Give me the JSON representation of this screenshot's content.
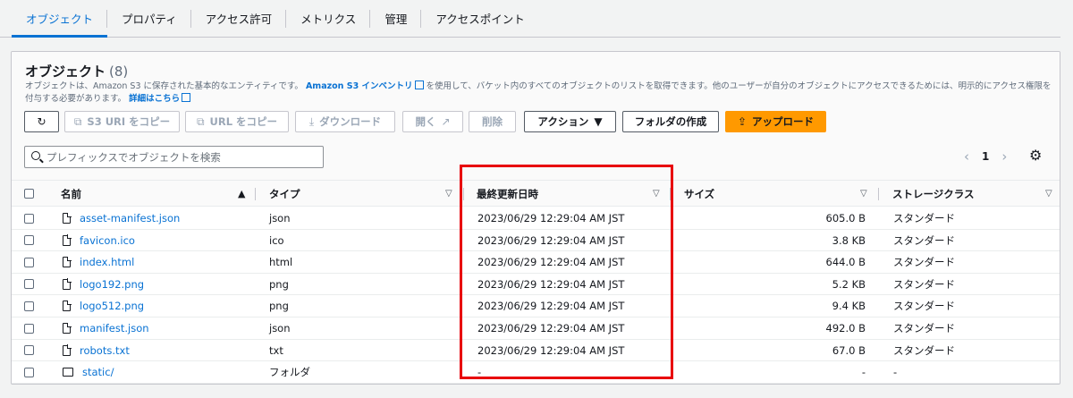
{
  "tabs": [
    {
      "label": "オブジェクト",
      "active": true
    },
    {
      "label": "プロパティ",
      "active": false
    },
    {
      "label": "アクセス許可",
      "active": false
    },
    {
      "label": "メトリクス",
      "active": false
    },
    {
      "label": "管理",
      "active": false
    },
    {
      "label": "アクセスポイント",
      "active": false
    }
  ],
  "objects": {
    "title": "オブジェクト",
    "count": "(8)",
    "description_pre": "オブジェクトは、Amazon S3 に保存された基本的なエンティティです。",
    "inventory_link": "Amazon S3 インベントリ",
    "description_mid": "を使用して、バケット内のすべてのオブジェクトのリストを取得できます。他のユーザーが自分のオブジェクトにアクセスできるためには、明示的にアクセス権限を付与する必要があります。",
    "details_link": "詳細はこちら"
  },
  "toolbar": {
    "copy_s3_uri": "S3 URI をコピー",
    "copy_url": "URL をコピー",
    "download": "ダウンロード",
    "open": "開く",
    "delete": "削除",
    "actions": "アクション",
    "create_folder": "フォルダの作成",
    "upload": "アップロード"
  },
  "search": {
    "placeholder": "プレフィックスでオブジェクトを検索"
  },
  "pagination": {
    "page": "1"
  },
  "table": {
    "columns": [
      "名前",
      "タイプ",
      "最終更新日時",
      "サイズ",
      "ストレージクラス"
    ],
    "rows": [
      {
        "name": "asset-manifest.json",
        "type": "json",
        "modified": "2023/06/29 12:29:04 AM JST",
        "size": "605.0 B",
        "storage": "スタンダード",
        "kind": "file"
      },
      {
        "name": "favicon.ico",
        "type": "ico",
        "modified": "2023/06/29 12:29:04 AM JST",
        "size": "3.8 KB",
        "storage": "スタンダード",
        "kind": "file"
      },
      {
        "name": "index.html",
        "type": "html",
        "modified": "2023/06/29 12:29:04 AM JST",
        "size": "644.0 B",
        "storage": "スタンダード",
        "kind": "file"
      },
      {
        "name": "logo192.png",
        "type": "png",
        "modified": "2023/06/29 12:29:04 AM JST",
        "size": "5.2 KB",
        "storage": "スタンダード",
        "kind": "file"
      },
      {
        "name": "logo512.png",
        "type": "png",
        "modified": "2023/06/29 12:29:04 AM JST",
        "size": "9.4 KB",
        "storage": "スタンダード",
        "kind": "file"
      },
      {
        "name": "manifest.json",
        "type": "json",
        "modified": "2023/06/29 12:29:04 AM JST",
        "size": "492.0 B",
        "storage": "スタンダード",
        "kind": "file"
      },
      {
        "name": "robots.txt",
        "type": "txt",
        "modified": "2023/06/29 12:29:04 AM JST",
        "size": "67.0 B",
        "storage": "スタンダード",
        "kind": "file"
      },
      {
        "name": "static/",
        "type": "フォルダ",
        "modified": "-",
        "size": "-",
        "storage": "-",
        "kind": "folder"
      }
    ]
  },
  "colors": {
    "accent": "#0972d3",
    "primary_button": "#ff9900",
    "highlight": "#e8000b"
  }
}
